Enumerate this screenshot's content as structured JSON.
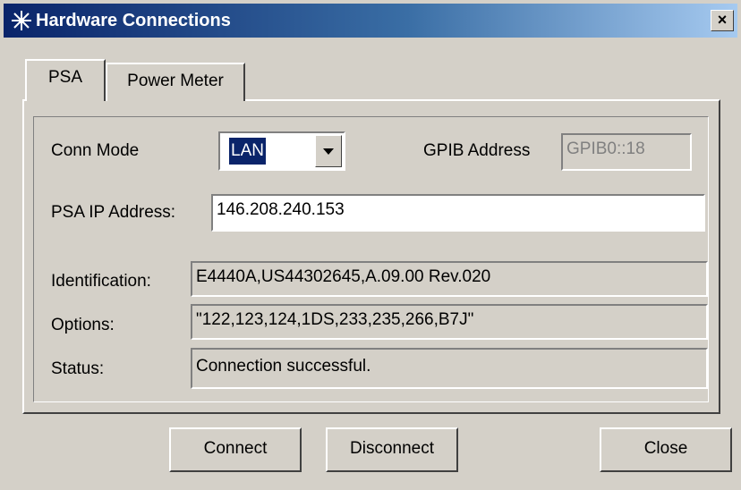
{
  "window": {
    "title": "Hardware Connections",
    "close_label": "×"
  },
  "tabs": [
    {
      "label": "PSA",
      "active": true
    },
    {
      "label": "Power Meter",
      "active": false
    }
  ],
  "form": {
    "conn_mode_label": "Conn Mode",
    "conn_mode_value": "LAN",
    "gpib_address_label": "GPIB Address",
    "gpib_address_value": "GPIB0::18",
    "psa_ip_label": "PSA IP Address:",
    "psa_ip_value": "146.208.240.153",
    "identification_label": "Identification:",
    "identification_value": "E4440A,US44302645,A.09.00 Rev.020",
    "options_label": "Options:",
    "options_value": "\"122,123,124,1DS,233,235,266,B7J\"",
    "status_label": "Status:",
    "status_value": "Connection successful."
  },
  "buttons": {
    "connect": "Connect",
    "disconnect": "Disconnect",
    "close": "Close"
  },
  "colors": {
    "titlebar_start": "#0a246a",
    "titlebar_end": "#a6caf0",
    "face": "#d4d0c8",
    "selection": "#0a246a"
  }
}
